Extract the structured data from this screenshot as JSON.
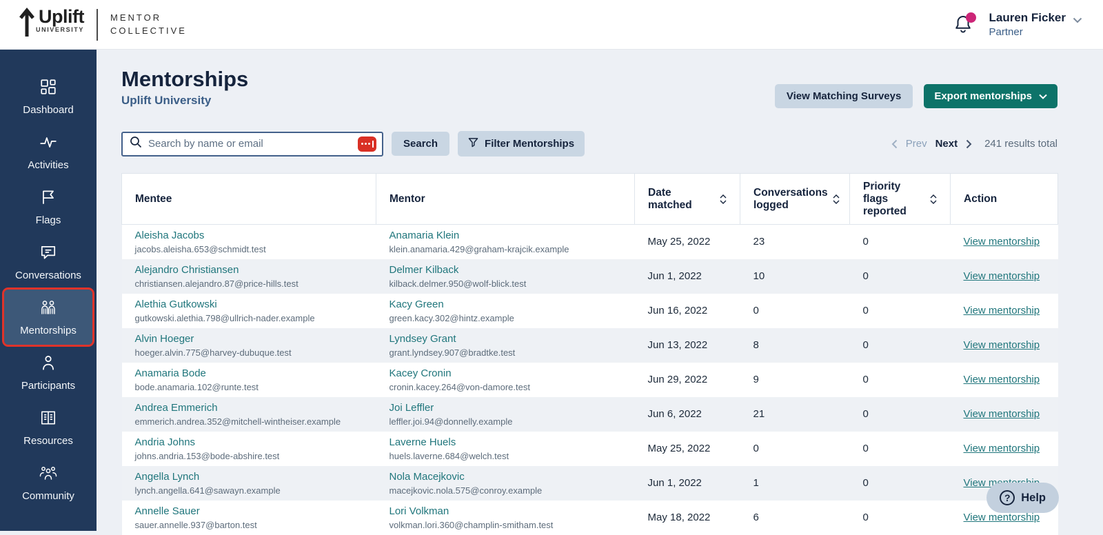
{
  "header": {
    "logo": {
      "brand": "Uplift",
      "university": "UNIVERSITY",
      "collective_line1": "MENTOR",
      "collective_line2": "COLLECTIVE"
    },
    "user": {
      "name": "Lauren Ficker",
      "role": "Partner"
    }
  },
  "sidebar": {
    "items": [
      {
        "label": "Dashboard"
      },
      {
        "label": "Activities"
      },
      {
        "label": "Flags"
      },
      {
        "label": "Conversations"
      },
      {
        "label": "Mentorships"
      },
      {
        "label": "Participants"
      },
      {
        "label": "Resources"
      },
      {
        "label": "Community"
      }
    ]
  },
  "page": {
    "title": "Mentorships",
    "subtitle": "Uplift University",
    "view_matching_surveys_label": "View Matching Surveys",
    "export_label": "Export mentorships",
    "search_placeholder": "Search by name or email",
    "search_button_label": "Search",
    "filter_button_label": "Filter Mentorships",
    "pagination": {
      "prev_label": "Prev",
      "next_label": "Next",
      "total_label": "241 results total"
    }
  },
  "table": {
    "columns": [
      {
        "label": "Mentee",
        "sortable": false
      },
      {
        "label": "Mentor",
        "sortable": false
      },
      {
        "label": "Date matched",
        "sortable": true
      },
      {
        "label": "Conversations logged",
        "sortable": true
      },
      {
        "label": "Priority flags reported",
        "sortable": true
      },
      {
        "label": "Action",
        "sortable": false
      }
    ],
    "action_label": "View mentorship",
    "rows": [
      {
        "mentee_name": "Aleisha Jacobs",
        "mentee_email": "jacobs.aleisha.653@schmidt.test",
        "mentor_name": "Anamaria Klein",
        "mentor_email": "klein.anamaria.429@graham-krajcik.example",
        "date": "May 25, 2022",
        "conversations": "23",
        "flags": "0"
      },
      {
        "mentee_name": "Alejandro Christiansen",
        "mentee_email": "christiansen.alejandro.87@price-hills.test",
        "mentor_name": "Delmer Kilback",
        "mentor_email": "kilback.delmer.950@wolf-blick.test",
        "date": "Jun 1, 2022",
        "conversations": "10",
        "flags": "0"
      },
      {
        "mentee_name": "Alethia Gutkowski",
        "mentee_email": "gutkowski.alethia.798@ullrich-nader.example",
        "mentor_name": "Kacy Green",
        "mentor_email": "green.kacy.302@hintz.example",
        "date": "Jun 16, 2022",
        "conversations": "0",
        "flags": "0"
      },
      {
        "mentee_name": "Alvin Hoeger",
        "mentee_email": "hoeger.alvin.775@harvey-dubuque.test",
        "mentor_name": "Lyndsey Grant",
        "mentor_email": "grant.lyndsey.907@bradtke.test",
        "date": "Jun 13, 2022",
        "conversations": "8",
        "flags": "0"
      },
      {
        "mentee_name": "Anamaria Bode",
        "mentee_email": "bode.anamaria.102@runte.test",
        "mentor_name": "Kacey Cronin",
        "mentor_email": "cronin.kacey.264@von-damore.test",
        "date": "Jun 29, 2022",
        "conversations": "9",
        "flags": "0"
      },
      {
        "mentee_name": "Andrea Emmerich",
        "mentee_email": "emmerich.andrea.352@mitchell-wintheiser.example",
        "mentor_name": "Joi Leffler",
        "mentor_email": "leffler.joi.94@donnelly.example",
        "date": "Jun 6, 2022",
        "conversations": "21",
        "flags": "0"
      },
      {
        "mentee_name": "Andria Johns",
        "mentee_email": "johns.andria.153@bode-abshire.test",
        "mentor_name": "Laverne Huels",
        "mentor_email": "huels.laverne.684@welch.test",
        "date": "May 25, 2022",
        "conversations": "0",
        "flags": "0"
      },
      {
        "mentee_name": "Angella Lynch",
        "mentee_email": "lynch.angella.641@sawayn.example",
        "mentor_name": "Nola Macejkovic",
        "mentor_email": "macejkovic.nola.575@conroy.example",
        "date": "Jun 1, 2022",
        "conversations": "1",
        "flags": "0"
      },
      {
        "mentee_name": "Annelle Sauer",
        "mentee_email": "sauer.annelle.937@barton.test",
        "mentor_name": "Lori Volkman",
        "mentor_email": "volkman.lori.360@champlin-smitham.test",
        "date": "May 18, 2022",
        "conversations": "6",
        "flags": "0"
      }
    ]
  },
  "help": {
    "label": "Help"
  },
  "colors": {
    "accent_teal": "#0d7369",
    "link_teal": "#20767c",
    "sidebar_navy": "#21395b",
    "annotation_red": "#e0332a",
    "badge_pink": "#cc2577"
  }
}
